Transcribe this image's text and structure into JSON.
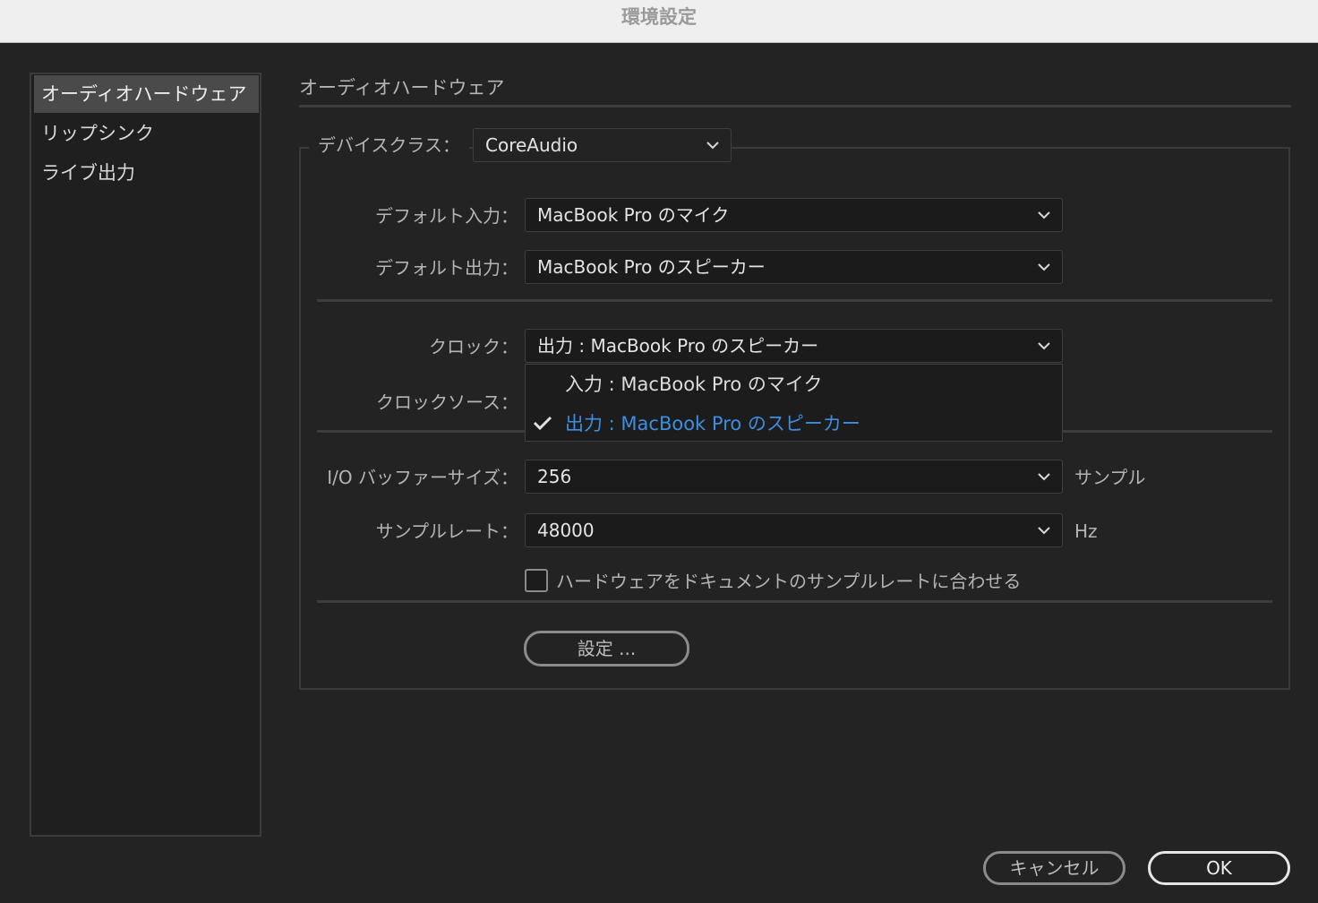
{
  "window": {
    "title": "環境設定"
  },
  "sidebar": {
    "items": [
      {
        "label": "オーディオハードウェア",
        "selected": true
      },
      {
        "label": "リップシンク",
        "selected": false
      },
      {
        "label": "ライブ出力",
        "selected": false
      }
    ]
  },
  "panel": {
    "title": "オーディオハードウェア",
    "device_class": {
      "label": "デバイスクラス：",
      "value": "CoreAudio"
    },
    "default_input": {
      "label": "デフォルト入力：",
      "value": "MacBook Pro のマイク"
    },
    "default_output": {
      "label": "デフォルト出力：",
      "value": "MacBook Pro のスピーカー"
    },
    "clock": {
      "label": "クロック：",
      "value": "出力 : MacBook Pro のスピーカー",
      "options": [
        {
          "label": "入力 : MacBook Pro のマイク",
          "checked": false
        },
        {
          "label": "出力 : MacBook Pro のスピーカー",
          "checked": true
        }
      ]
    },
    "clock_source": {
      "label": "クロックソース："
    },
    "buffer_size": {
      "label": "I/O バッファーサイズ：",
      "value": "256",
      "unit": "サンプル"
    },
    "sample_rate": {
      "label": "サンプルレート：",
      "value": "48000",
      "unit": "Hz"
    },
    "match_sample_rate": {
      "label": "ハードウェアをドキュメントのサンプルレートに合わせる",
      "checked": false
    },
    "settings_button": "設定 ..."
  },
  "footer": {
    "cancel": "キャンセル",
    "ok": "OK"
  },
  "colors": {
    "accent": "#3d8ee0",
    "background": "#232323",
    "selected_item": "#4a4a4a"
  },
  "icons": {
    "dropdown": "chevron-down-icon",
    "checkmark": "checkmark-icon"
  }
}
